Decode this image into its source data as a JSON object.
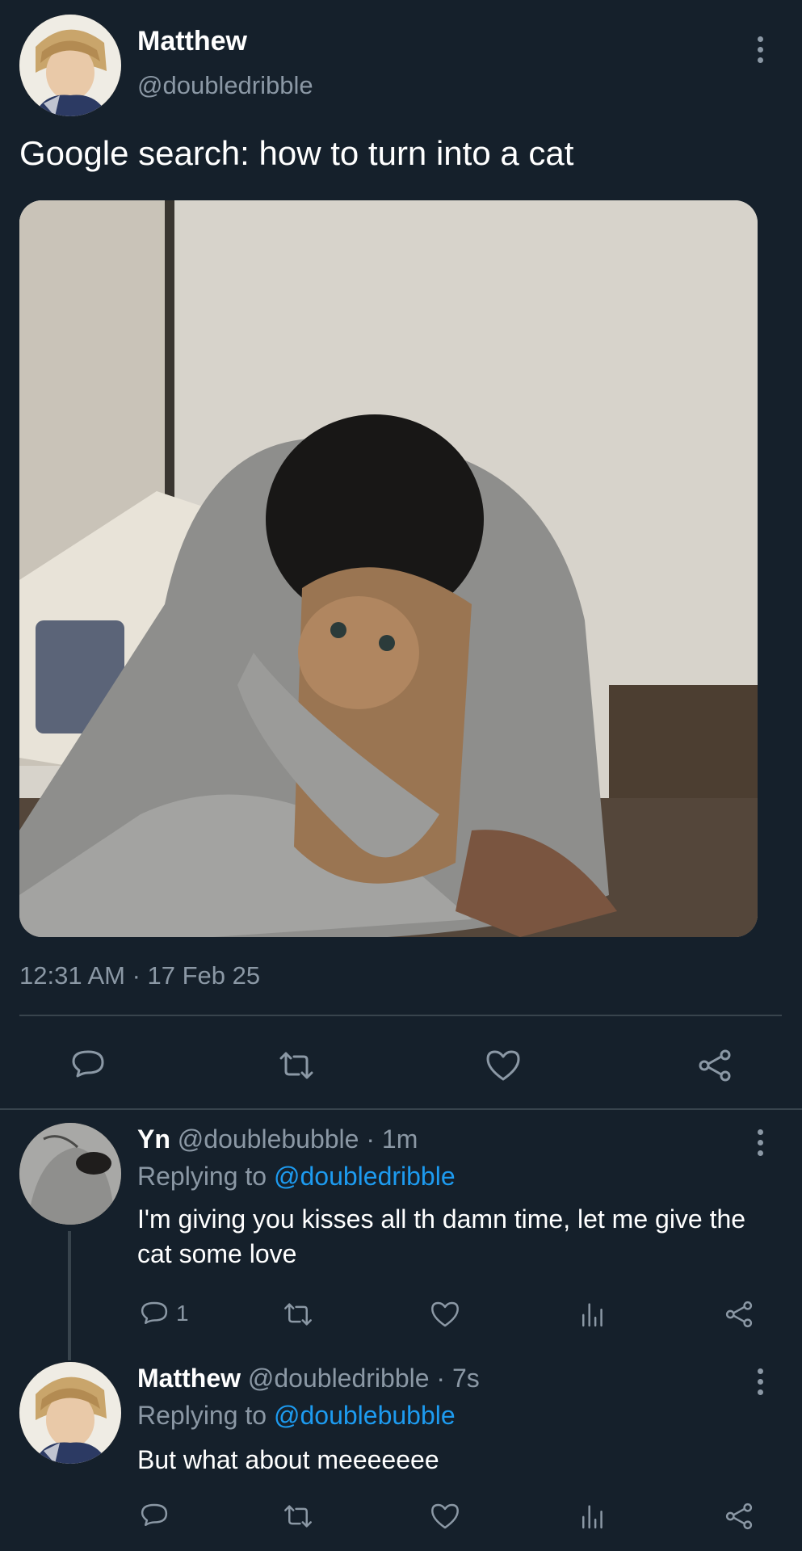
{
  "tweet": {
    "author_name": "Matthew",
    "author_handle": "@doubledribble",
    "text": "Google search: how to turn into a cat",
    "timestamp": "12:31 AM · 17 Feb 25",
    "actions": {
      "reply_icon": "reply-icon",
      "retweet_icon": "retweet-icon",
      "like_icon": "like-icon",
      "share_icon": "share-icon"
    }
  },
  "replies": [
    {
      "author_name": "Yn",
      "meta": "@doublebubble · 1m",
      "replying_prefix": "Replying to ",
      "replying_to": "@doubledribble",
      "text": "I'm giving you kisses all th damn time, let me give the cat some love",
      "reply_count": "1"
    },
    {
      "author_name": "Matthew",
      "meta": "@doubledribble · 7s",
      "replying_prefix": "Replying to ",
      "replying_to": "@doublebubble",
      "text": "But what about meeeeeee",
      "reply_count": ""
    }
  ],
  "colors": {
    "background": "#15202b",
    "muted": "#8b98a5",
    "link": "#1d9bf0",
    "divider": "#38444d"
  }
}
